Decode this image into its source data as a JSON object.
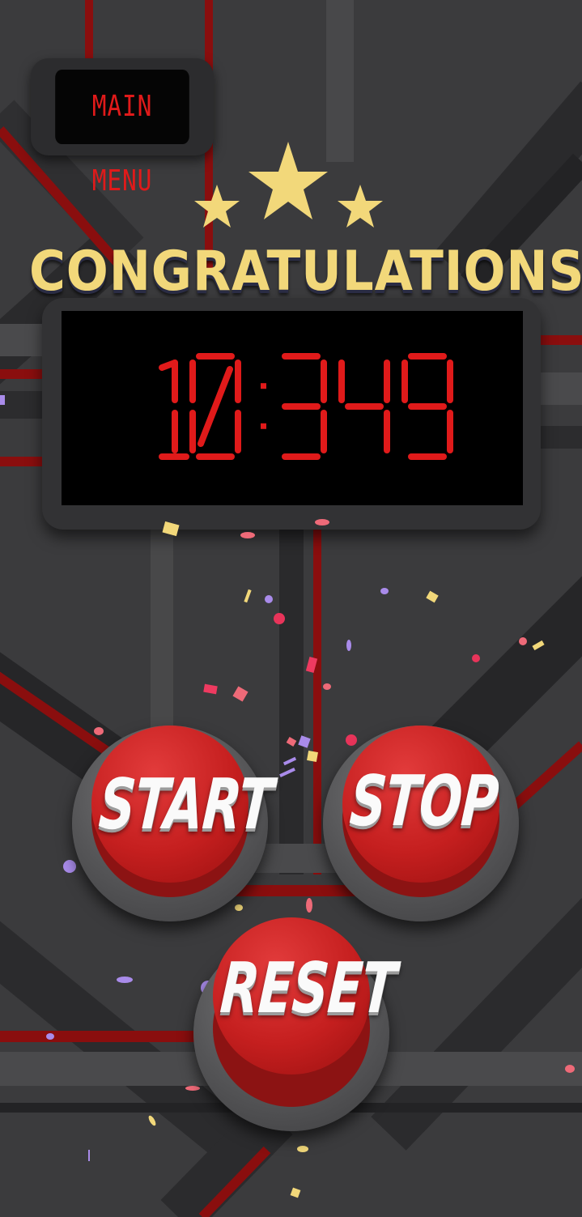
{
  "menu": {
    "main_menu_label": "MAIN MENU"
  },
  "result": {
    "title": "CONGRATULATIONS",
    "stars": 3
  },
  "timer": {
    "value": "10:349"
  },
  "controls": {
    "start_label": "START",
    "stop_label": "STOP",
    "reset_label": "RESET"
  },
  "colors": {
    "accent_red": "#e01a1a",
    "title_yellow": "#f2d87a",
    "button_red": "#c51f1f"
  }
}
